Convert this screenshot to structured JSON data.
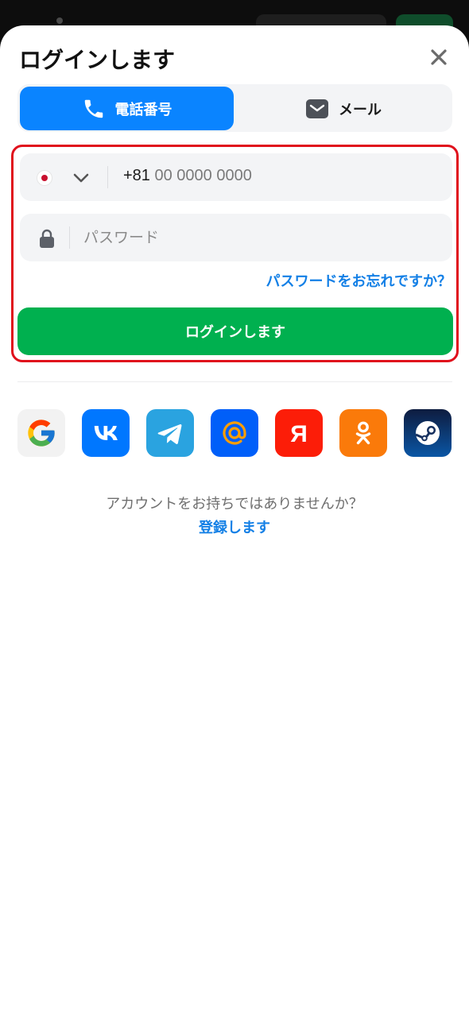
{
  "header": {
    "title": "ログインします"
  },
  "tabs": [
    {
      "label": "電話番号",
      "icon": "phone-icon",
      "active": true
    },
    {
      "label": "メール",
      "icon": "mail-icon",
      "active": false
    }
  ],
  "phone_field": {
    "country_flag": "japan-flag",
    "country_code": "+81",
    "placeholder": "00 0000 0000"
  },
  "password_field": {
    "placeholder": "パスワード",
    "icon": "lock-icon"
  },
  "forgot_password": "パスワードをお忘れですか？",
  "login_button": "ログインします",
  "social_logins": [
    {
      "name": "google",
      "icon": "google-icon",
      "bg": "#f2f2f2"
    },
    {
      "name": "vk",
      "icon": "vk-icon",
      "bg": "#0077ff"
    },
    {
      "name": "telegram",
      "icon": "telegram-icon",
      "bg": "#2aa3e0"
    },
    {
      "name": "mail.ru",
      "icon": "mailru-at-icon",
      "bg": "#005ff9"
    },
    {
      "name": "yandex",
      "icon": "yandex-icon",
      "bg": "#fc1d08"
    },
    {
      "name": "odnoklassniki",
      "icon": "ok-icon",
      "bg": "#fa7a0a"
    },
    {
      "name": "steam",
      "icon": "steam-icon",
      "bg": "#0c2a63"
    }
  ],
  "signup": {
    "prompt": "アカウントをお持ちではありませんか？",
    "link": "登録します"
  },
  "colors": {
    "accent_blue": "#0a84ff",
    "link_blue": "#1480e6",
    "login_green": "#00b04f",
    "highlight_red": "#e0101c"
  }
}
